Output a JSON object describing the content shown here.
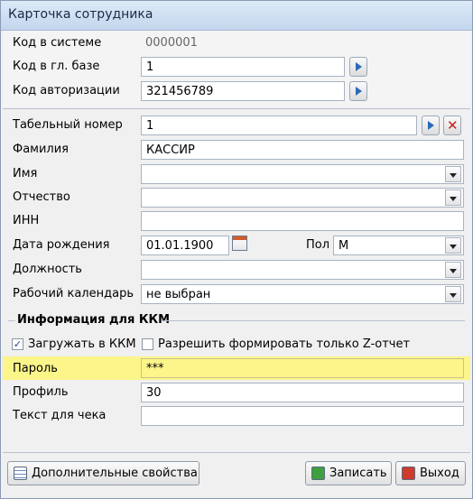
{
  "window": {
    "title": "Карточка сотрудника"
  },
  "top_section": {
    "system_code_label": "Код в системе",
    "system_code_value": "0000001",
    "main_base_code_label": "Код в гл. базе",
    "main_base_code_value": "1",
    "auth_code_label": "Код авторизации",
    "auth_code_value": "321456789"
  },
  "employee": {
    "tab_number_label": "Табельный номер",
    "tab_number_value": "1",
    "surname_label": "Фамилия",
    "surname_value": "КАССИР",
    "name_label": "Имя",
    "name_value": "",
    "patronymic_label": "Отчество",
    "patronymic_value": "",
    "inn_label": "ИНН",
    "inn_value": "",
    "birth_date_label": "Дата рождения",
    "birth_date_value": "01.01.1900",
    "gender_label": "Пол",
    "gender_value": "М",
    "position_label": "Должность",
    "position_value": "",
    "calendar_label": "Рабочий календарь",
    "calendar_value": "не выбран"
  },
  "kkm": {
    "section_title": "Информация для ККМ",
    "load_to_kkm_label": "Загружать в ККМ",
    "load_to_kkm_checked": true,
    "allow_z_only_label": "Разрешить формировать только Z-отчет",
    "allow_z_only_checked": false,
    "password_label": "Пароль",
    "password_value": "***",
    "profile_label": "Профиль",
    "profile_value": "30",
    "receipt_text_label": "Текст для чека",
    "receipt_text_value": ""
  },
  "footer": {
    "extra_props_label": "Дополнительные свойства",
    "save_label": "Записать",
    "exit_label": "Выход"
  },
  "colors": {
    "highlight": "#fbf58a",
    "accent": "#2a6bb8",
    "danger": "#c62020"
  },
  "icons": [
    "arrow-right-icon",
    "delete-icon",
    "dropdown-arrow-icon",
    "calendar-icon",
    "checkbox-icon",
    "table-icon",
    "save-icon",
    "exit-icon"
  ]
}
